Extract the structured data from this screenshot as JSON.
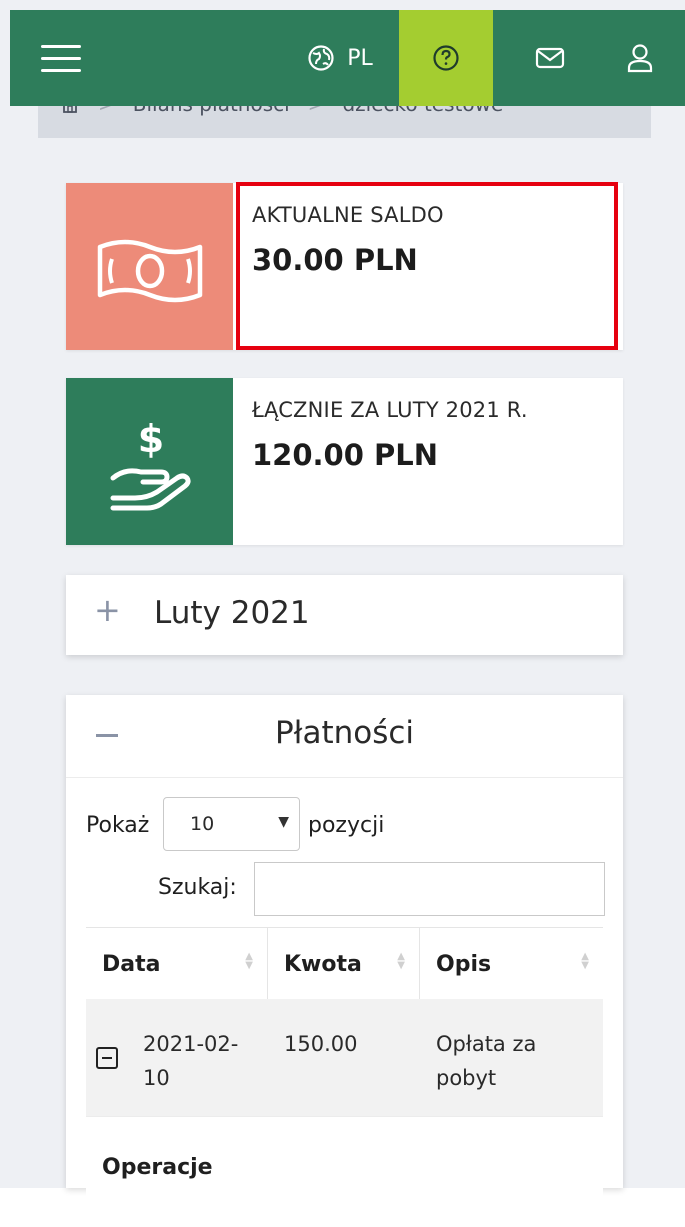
{
  "header": {
    "menu_icon": "hamburger-menu-icon",
    "language": "PL",
    "language_icon": "globe-icon",
    "help_icon": "help-circle-icon",
    "mail_icon": "envelope-icon",
    "user_icon": "user-icon",
    "colors": {
      "bar": "#2e7d5b",
      "help_bg": "#a4cd30"
    }
  },
  "breadcrumb": {
    "home_icon": "home-icon",
    "items": [
      "Bilans płatności",
      "dziecko testowe"
    ],
    "separator": ">"
  },
  "cards": [
    {
      "label": "AKTUALNE SALDO",
      "value": "30.00 PLN",
      "icon": "banknote-icon",
      "color": "#ed8b79"
    },
    {
      "label": "ŁĄCZNIE ZA LUTY 2021 R.",
      "value": "120.00 PLN",
      "icon": "hand-dollar-icon",
      "color": "#2e7d5b"
    }
  ],
  "month_accordion": {
    "toggle": "+",
    "title": "Luty 2021"
  },
  "payments": {
    "toggle": "−",
    "title": "Płatności",
    "show_label": "Pokaż",
    "page_size": "10",
    "show_after": "pozycji",
    "search_label": "Szukaj:",
    "search_value": "",
    "columns": [
      "Data",
      "Kwota",
      "Opis"
    ],
    "rows": [
      {
        "date_line1": "2021-02-",
        "date_line2": "10",
        "amount": "150.00",
        "desc_line1": "Opłata za",
        "desc_line2": "pobyt"
      }
    ],
    "detail_label": "Operacje"
  }
}
